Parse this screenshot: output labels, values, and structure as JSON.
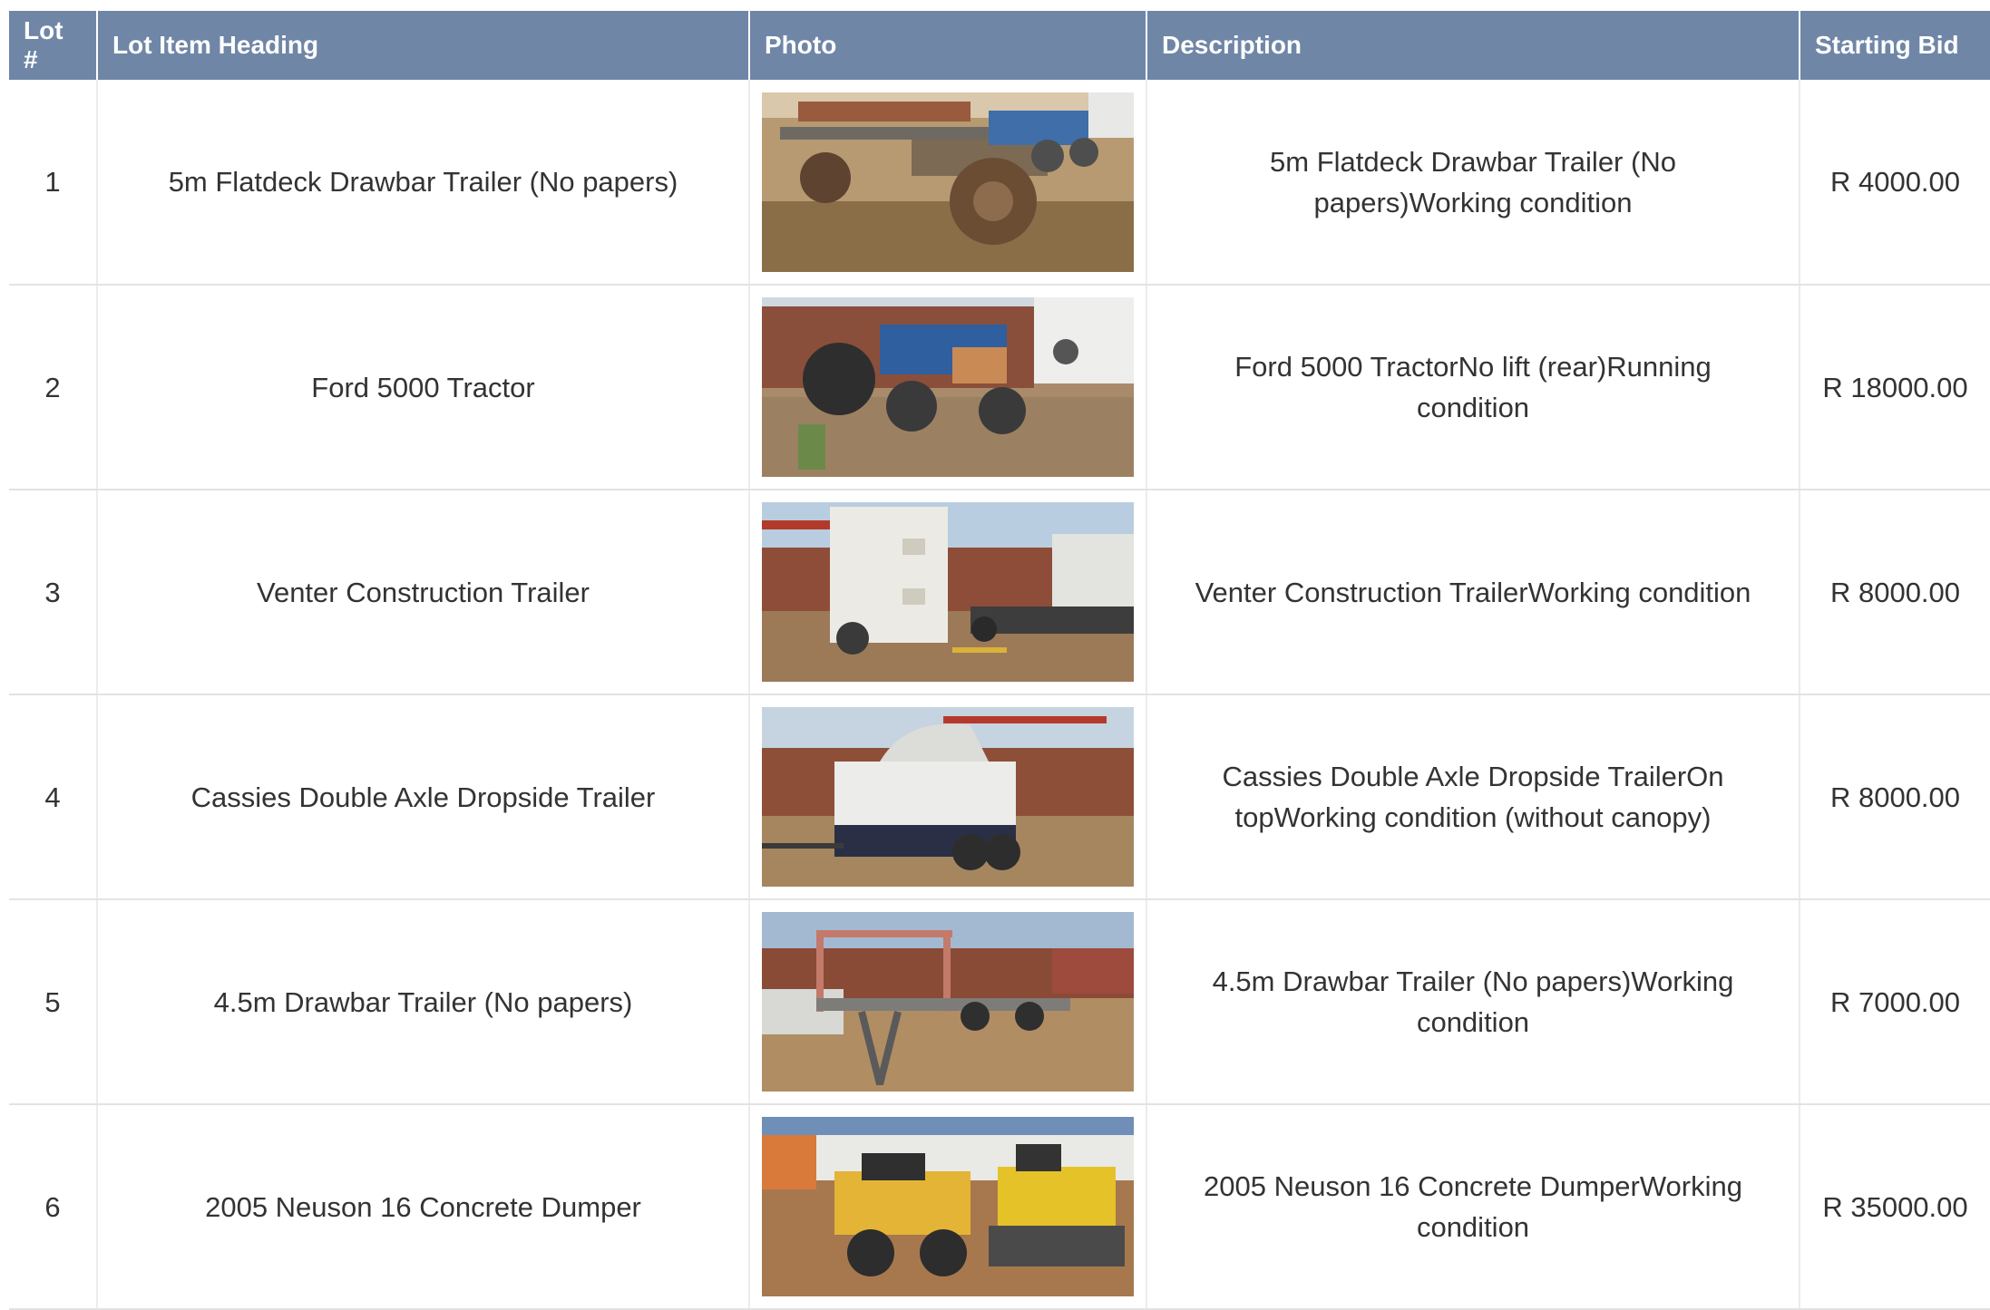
{
  "table": {
    "headers": {
      "lot": "Lot #",
      "heading": "Lot Item Heading",
      "photo": "Photo",
      "description": "Description",
      "bid": "Starting Bid"
    },
    "rows": [
      {
        "lot": "1",
        "heading": "5m Flatdeck Drawbar Trailer (No papers)",
        "photo": "flatdeck-trailer-photo",
        "description": "5m Flatdeck Drawbar Trailer (No papers)Working condition",
        "bid": "R 4000.00"
      },
      {
        "lot": "2",
        "heading": "Ford 5000 Tractor",
        "photo": "tractor-photo",
        "description": "Ford 5000 TractorNo lift (rear)Running condition",
        "bid": "R 18000.00"
      },
      {
        "lot": "3",
        "heading": "Venter Construction Trailer",
        "photo": "construction-trailer-photo",
        "description": "Venter Construction TrailerWorking condition",
        "bid": "R 8000.00"
      },
      {
        "lot": "4",
        "heading": "Cassies Double Axle Dropside Trailer",
        "photo": "dropside-trailer-photo",
        "description": "Cassies Double Axle Dropside TrailerOn topWorking condition (without canopy)",
        "bid": "R 8000.00"
      },
      {
        "lot": "5",
        "heading": "4.5m Drawbar Trailer (No papers)",
        "photo": "drawbar-trailer-photo",
        "description": "4.5m Drawbar Trailer (No papers)Working condition",
        "bid": "R 7000.00"
      },
      {
        "lot": "6",
        "heading": "2005 Neuson 16 Concrete Dumper",
        "photo": "concrete-dumper-photo",
        "description": "2005 Neuson 16 Concrete DumperWorking condition",
        "bid": "R 35000.00"
      }
    ]
  },
  "colors": {
    "header_bg": "#6f86a6",
    "header_text": "#ffffff",
    "body_text": "#333333",
    "grid_line": "#e3e3e3"
  }
}
